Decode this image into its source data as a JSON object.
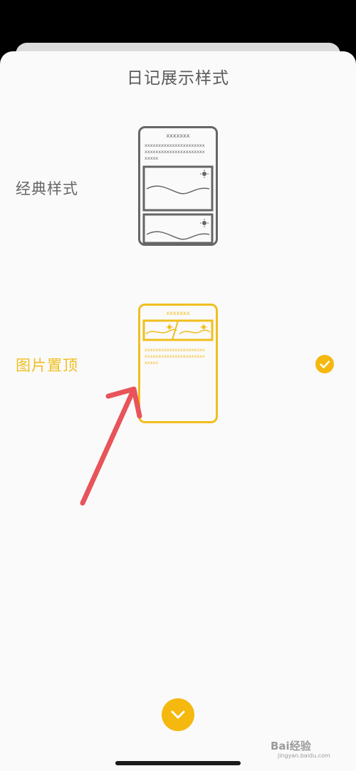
{
  "sheet": {
    "title": "日记展示样式"
  },
  "options": [
    {
      "label": "经典样式",
      "placeholder_title": "xxxxxxx",
      "placeholder_lines": [
        "xxxxxxxxxxxxxxxxxxxxxx",
        "xxxxxxxxxxxxxxxxxxxxxx",
        "xxxxx"
      ],
      "selected": false,
      "color": "#666666"
    },
    {
      "label": "图片置顶",
      "placeholder_title": "xxxxxxx",
      "placeholder_lines": [
        "xxxxxxxxxxxxxxxxxxxxxx",
        "xxxxxxxxxxxxxxxxxxxxxx",
        "xxxxx"
      ],
      "selected": true,
      "color": "#f0be1e"
    }
  ],
  "icons": {
    "selected_check": "check-circle-icon",
    "collapse": "chevron-down-icon",
    "sun": "sun-icon"
  },
  "colors": {
    "accent": "#f5b80e",
    "annotation_arrow": "#e8545a"
  },
  "watermark": {
    "brand": "Bai",
    "brand_suffix": "经验",
    "url": "jingyan.baidu.com"
  }
}
